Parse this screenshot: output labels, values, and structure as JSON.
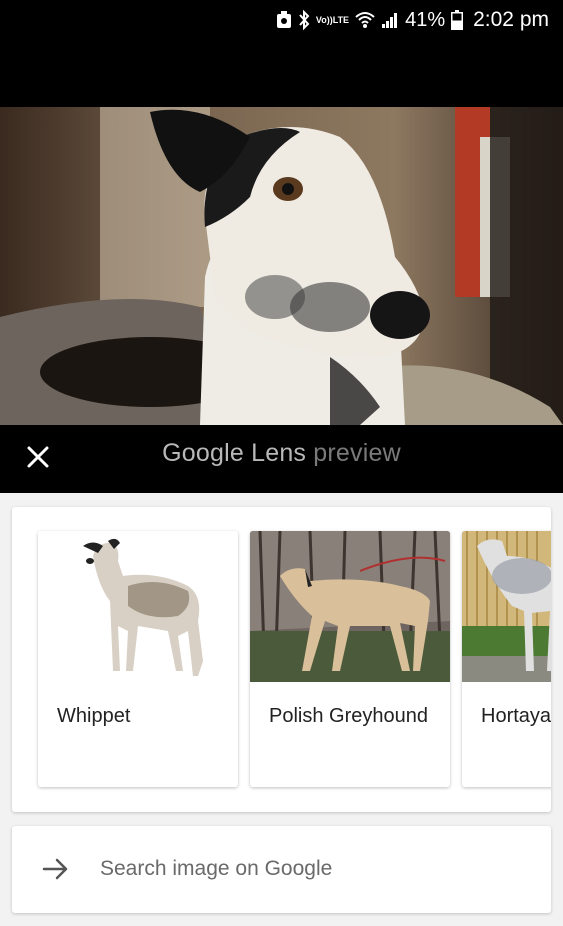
{
  "status_bar": {
    "volte_top": "Vo))",
    "volte_bottom": "LTE",
    "battery_percent": "41%",
    "time": "2:02 pm"
  },
  "lens_bar": {
    "brand": "Google",
    "product": "Lens",
    "mode": "preview"
  },
  "results": [
    {
      "label": "Whippet"
    },
    {
      "label": "Polish Greyhound"
    },
    {
      "label": "Hortaya"
    }
  ],
  "search": {
    "label": "Search image on Google"
  },
  "colors": {
    "status_bar_bg": "#000000",
    "sheet_bg": "#f2f2f2",
    "card_bg": "#ffffff",
    "search_text": "#6a6a6a"
  },
  "icons": [
    "notification-icon",
    "bluetooth-icon",
    "wifi-icon",
    "signal-icon",
    "battery-icon",
    "close-icon",
    "arrow-right-icon"
  ]
}
